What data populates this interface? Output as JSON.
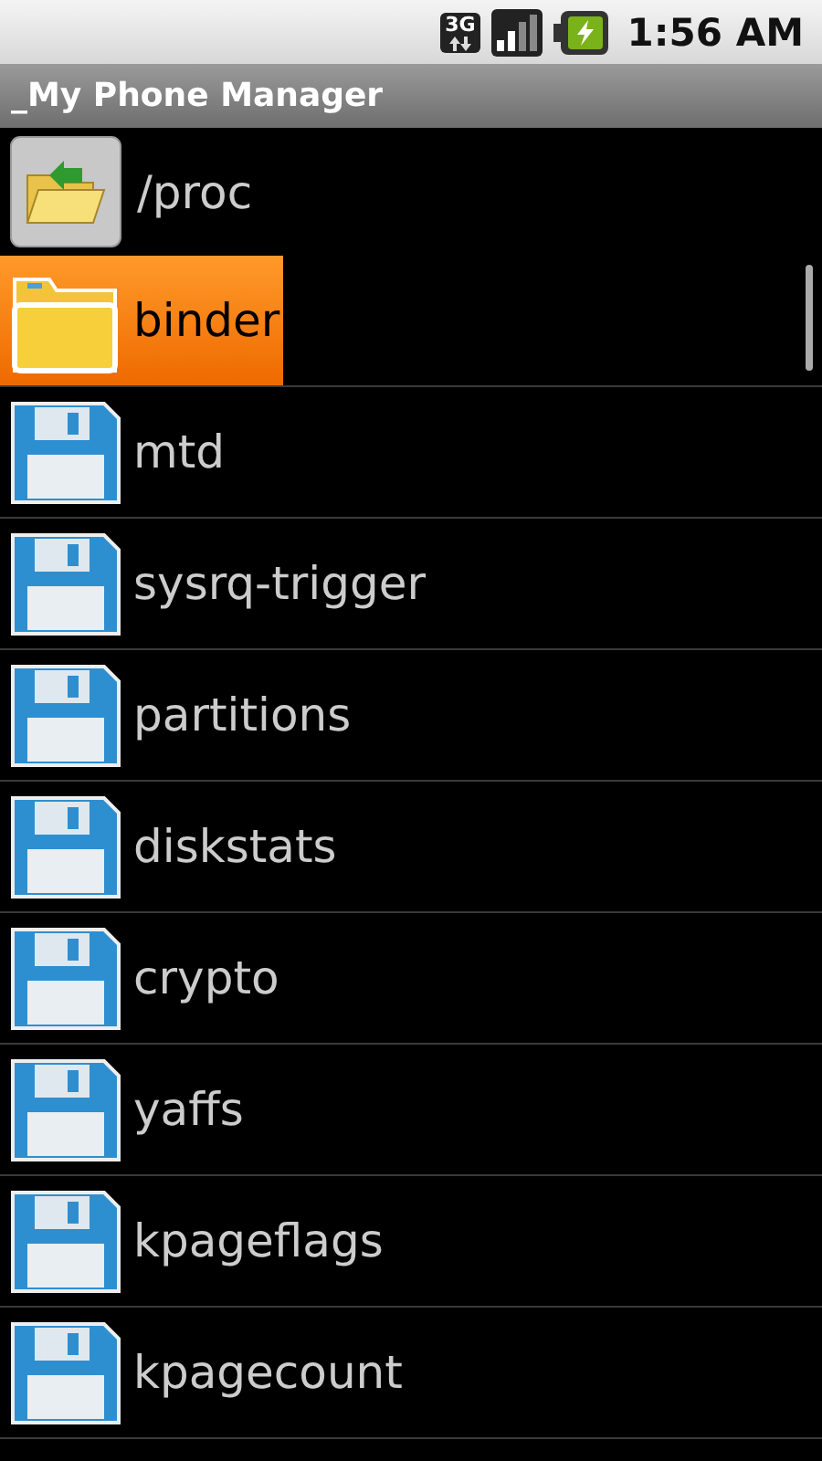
{
  "status_bar": {
    "time": "1:56 AM",
    "network": "3G"
  },
  "title_bar": {
    "title": "_My Phone Manager"
  },
  "up_row": {
    "path": "/proc"
  },
  "files": [
    {
      "name": "binder",
      "kind": "folder",
      "selected": true
    },
    {
      "name": "mtd",
      "kind": "file",
      "selected": false
    },
    {
      "name": "sysrq-trigger",
      "kind": "file",
      "selected": false
    },
    {
      "name": "partitions",
      "kind": "file",
      "selected": false
    },
    {
      "name": "diskstats",
      "kind": "file",
      "selected": false
    },
    {
      "name": "crypto",
      "kind": "file",
      "selected": false
    },
    {
      "name": "yaffs",
      "kind": "file",
      "selected": false
    },
    {
      "name": "kpageflags",
      "kind": "file",
      "selected": false
    },
    {
      "name": "kpagecount",
      "kind": "file",
      "selected": false
    }
  ]
}
